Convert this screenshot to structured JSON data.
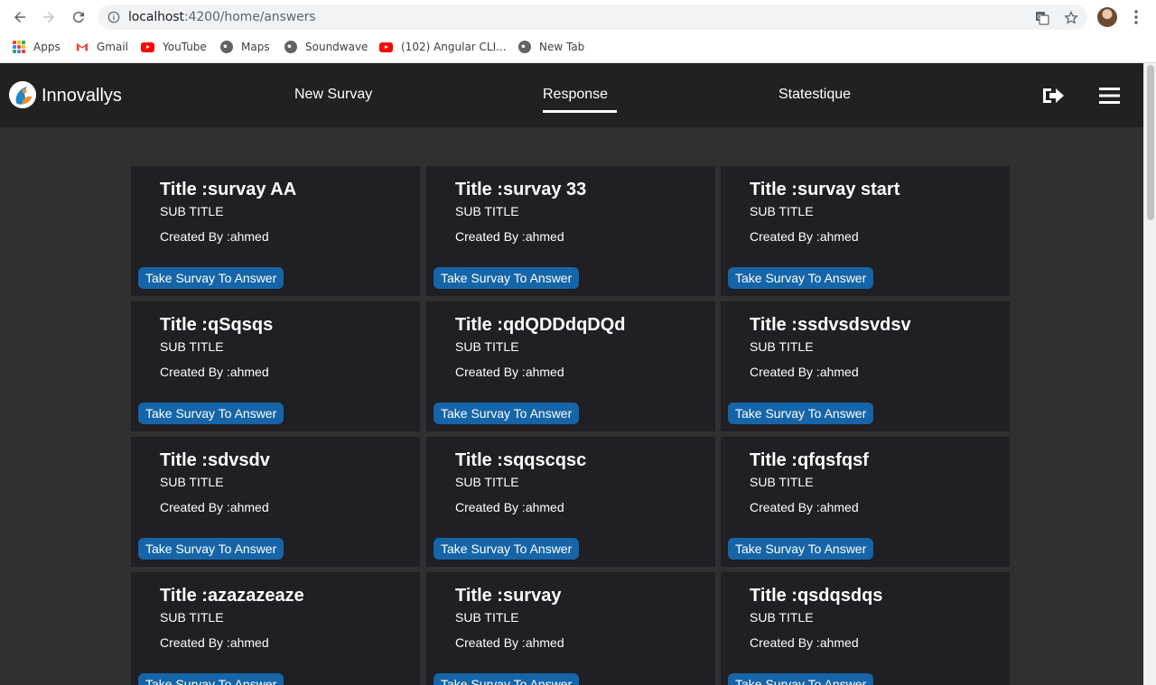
{
  "browser": {
    "url_host": "localhost",
    "url_path": ":4200/home/answers",
    "bookmarks": [
      {
        "label": "Apps",
        "icon": "apps-icon"
      },
      {
        "label": "Gmail",
        "icon": "gmail-icon"
      },
      {
        "label": "YouTube",
        "icon": "youtube-icon"
      },
      {
        "label": "Maps",
        "icon": "globe-icon"
      },
      {
        "label": "Soundwave",
        "icon": "globe-icon"
      },
      {
        "label": "(102) Angular CLI...",
        "icon": "youtube-icon"
      },
      {
        "label": "New Tab",
        "icon": "globe-icon"
      }
    ]
  },
  "app": {
    "brand": "Innovallys",
    "tabs": [
      {
        "label": "New Survay",
        "active": false
      },
      {
        "label": "Response",
        "active": true
      },
      {
        "label": "Statestique",
        "active": false
      }
    ]
  },
  "cards": [
    {
      "title": "Title :survay AA",
      "subtitle": "SUB TITLE",
      "author": "Created By :ahmed",
      "button": "Take Survay To Answer"
    },
    {
      "title": "Title :survay 33",
      "subtitle": "SUB TITLE",
      "author": "Created By :ahmed",
      "button": "Take Survay To Answer"
    },
    {
      "title": "Title :survay start",
      "subtitle": "SUB TITLE",
      "author": "Created By :ahmed",
      "button": "Take Survay To Answer"
    },
    {
      "title": "Title :qSqsqs",
      "subtitle": "SUB TITLE",
      "author": "Created By :ahmed",
      "button": "Take Survay To Answer"
    },
    {
      "title": "Title :qdQDDdqDQd",
      "subtitle": "SUB TITLE",
      "author": "Created By :ahmed",
      "button": "Take Survay To Answer"
    },
    {
      "title": "Title :ssdvsdsvdsv",
      "subtitle": "SUB TITLE",
      "author": "Created By :ahmed",
      "button": "Take Survay To Answer"
    },
    {
      "title": "Title :sdvsdv",
      "subtitle": "SUB TITLE",
      "author": "Created By :ahmed",
      "button": "Take Survay To Answer"
    },
    {
      "title": "Title :sqqscqsc",
      "subtitle": "SUB TITLE",
      "author": "Created By :ahmed",
      "button": "Take Survay To Answer"
    },
    {
      "title": "Title :qfqsfqsf",
      "subtitle": "SUB TITLE",
      "author": "Created By :ahmed",
      "button": "Take Survay To Answer"
    },
    {
      "title": "Title :azazazeaze",
      "subtitle": "SUB TITLE",
      "author": "Created By :ahmed",
      "button": "Take Survay To Answer"
    },
    {
      "title": "Title :survay",
      "subtitle": "SUB TITLE",
      "author": "Created By :ahmed",
      "button": "Take Survay To Answer"
    },
    {
      "title": "Title :qsdqsdqs",
      "subtitle": "SUB TITLE",
      "author": "Created By :ahmed",
      "button": "Take Survay To Answer"
    }
  ],
  "colors": {
    "topbar": "#212121",
    "page_background": "#303030",
    "card_background": "#1f1f24",
    "button": "#1565a8"
  }
}
